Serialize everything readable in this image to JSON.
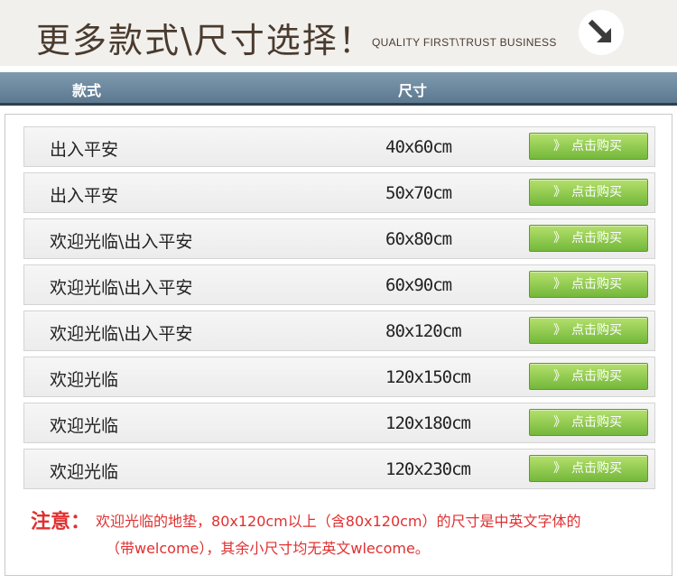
{
  "header": {
    "title": "更多款式\\尺寸选择！",
    "subtitle": "QUALITY FIRST\\TRUST BUSINESS"
  },
  "columns": {
    "style": "款式",
    "size": "尺寸"
  },
  "rows": [
    {
      "style": "出入平安",
      "size": "40x60cm",
      "button": "点击购买"
    },
    {
      "style": "出入平安",
      "size": "50x70cm",
      "button": "点击购买"
    },
    {
      "style": "欢迎光临\\出入平安",
      "size": "60x80cm",
      "button": "点击购买"
    },
    {
      "style": "欢迎光临\\出入平安",
      "size": "60x90cm",
      "button": "点击购买"
    },
    {
      "style": "欢迎光临\\出入平安",
      "size": "80x120cm",
      "button": "点击购买"
    },
    {
      "style": "欢迎光临",
      "size": "120x150cm",
      "button": "点击购买"
    },
    {
      "style": "欢迎光临",
      "size": "120x180cm",
      "button": "点击购买"
    },
    {
      "style": "欢迎光临",
      "size": "120x230cm",
      "button": "点击购买"
    }
  ],
  "note": {
    "label": "注意：",
    "line1": "欢迎光临的地垫，80x120cm以上（含80x120cm）的尺寸是中英文字体的",
    "line2": "（带welcome），其余小尺寸均无英文wlecome。"
  },
  "icons": {
    "header_arrow": "arrow-down-right-icon",
    "buy_chevron": "chevron-right-icon"
  },
  "colors": {
    "header_bg": "#f2f0ed",
    "column_bar": "#6d879d",
    "button_green": "#8cc84b",
    "note_red": "#e03030"
  }
}
